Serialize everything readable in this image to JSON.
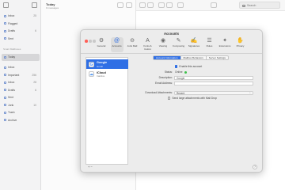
{
  "sidebar": {
    "rows_top": [
      {
        "label": "Inbox",
        "count": "25"
      },
      {
        "label": "Flagged",
        "count": ""
      },
      {
        "label": "Drafts",
        "count": "6"
      },
      {
        "label": "Sent",
        "count": ""
      }
    ],
    "heading": "Smart Mailboxes",
    "selected_label": "Today",
    "rows_bottom": [
      {
        "label": "Inbox",
        "count": ""
      },
      {
        "label": "Important",
        "count": "256"
      },
      {
        "label": "Inbox",
        "count": "28"
      },
      {
        "label": "Drafts",
        "count": "6"
      },
      {
        "label": "Sent",
        "count": ""
      },
      {
        "label": "Junk",
        "count": "10"
      },
      {
        "label": "Trash",
        "count": ""
      },
      {
        "label": "Archive",
        "count": ""
      }
    ]
  },
  "list": {
    "title": "Today",
    "subtitle": "0 messages"
  },
  "search": {
    "placeholder": "Search"
  },
  "prefs": {
    "title": "Accounts",
    "tabs": [
      {
        "label": "General",
        "icon": "⚙"
      },
      {
        "label": "Accounts",
        "icon": "@"
      },
      {
        "label": "Junk Mail",
        "icon": "⊖"
      },
      {
        "label": "Fonts & Colors",
        "icon": "A"
      },
      {
        "label": "Viewing",
        "icon": "◉"
      },
      {
        "label": "Composing",
        "icon": "✎"
      },
      {
        "label": "Signatures",
        "icon": "✍"
      },
      {
        "label": "Rules",
        "icon": "☰"
      },
      {
        "label": "Extensions",
        "icon": "✦"
      },
      {
        "label": "Privacy",
        "icon": "✋"
      }
    ],
    "accounts": [
      {
        "name": "Google",
        "type": "Gmail",
        "glyph": "G"
      },
      {
        "name": "iCloud",
        "type": "Inactive",
        "glyph": "☁"
      }
    ],
    "segments": [
      "Account Information",
      "Mailbox Behaviors",
      "Server Settings"
    ],
    "enable_label": "Enable this account",
    "status_label": "Status:",
    "status_value": "Online",
    "description_label": "Description:",
    "description_value": "Google",
    "email_label": "Email Address:",
    "email_value": "",
    "download_label": "Download Attachments:",
    "download_value": "Recent",
    "send_large_label": "Send large attachments with Mail Drop",
    "add_remove": "+  −",
    "help": "?"
  }
}
